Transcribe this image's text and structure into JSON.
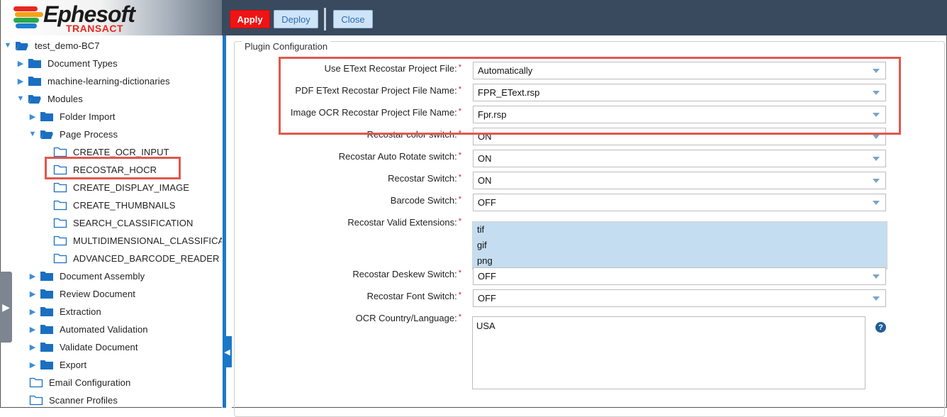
{
  "branding": {
    "name": "Ephesoft",
    "product": "TRANSACT"
  },
  "toolbar": {
    "apply_label": "Apply",
    "deploy_label": "Deploy",
    "close_label": "Close"
  },
  "tree": {
    "root": "test_demo-BC7",
    "items": [
      {
        "label": "Document Types"
      },
      {
        "label": "machine-learning-dictionaries"
      },
      {
        "label": "Modules"
      },
      {
        "label": "Folder Import"
      },
      {
        "label": "Page Process"
      },
      {
        "label": "CREATE_OCR_INPUT"
      },
      {
        "label": "RECOSTAR_HOCR"
      },
      {
        "label": "CREATE_DISPLAY_IMAGE"
      },
      {
        "label": "CREATE_THUMBNAILS"
      },
      {
        "label": "SEARCH_CLASSIFICATION"
      },
      {
        "label": "MULTIDIMENSIONAL_CLASSIFICA"
      },
      {
        "label": "ADVANCED_BARCODE_READER"
      },
      {
        "label": "Document Assembly"
      },
      {
        "label": "Review Document"
      },
      {
        "label": "Extraction"
      },
      {
        "label": "Automated Validation"
      },
      {
        "label": "Validate Document"
      },
      {
        "label": "Export"
      },
      {
        "label": "Email Configuration"
      },
      {
        "label": "Scanner Profiles"
      }
    ]
  },
  "config": {
    "legend": "Plugin Configuration",
    "required_mark": "*",
    "fields": [
      {
        "label": "Use EText Recostar Project File:",
        "value": "Automatically"
      },
      {
        "label": "PDF EText Recostar Project File Name:",
        "value": "FPR_EText.rsp"
      },
      {
        "label": "Image OCR Recostar Project File Name:",
        "value": "Fpr.rsp"
      },
      {
        "label": "Recostar color switch:",
        "value": "ON"
      },
      {
        "label": "Recostar Auto Rotate switch:",
        "value": "ON"
      },
      {
        "label": "Recostar Switch:",
        "value": "ON"
      },
      {
        "label": "Barcode Switch:",
        "value": "OFF"
      }
    ],
    "extensions": {
      "label": "Recostar Valid Extensions:",
      "options": [
        "tif",
        "gif",
        "png"
      ]
    },
    "fields2": [
      {
        "label": "Recostar Deskew Switch:",
        "value": "OFF"
      },
      {
        "label": "Recostar Font Switch:",
        "value": "OFF"
      }
    ],
    "language": {
      "label": "OCR Country/Language:",
      "value": "USA"
    },
    "help_icon": "?"
  },
  "colors": {
    "toolbar_bg": "#394a5e",
    "apply_bg": "#ee1414",
    "accent_blue": "#1a78c8",
    "highlight_red": "#e0584d",
    "folder_blue": "#1a6fc0"
  }
}
